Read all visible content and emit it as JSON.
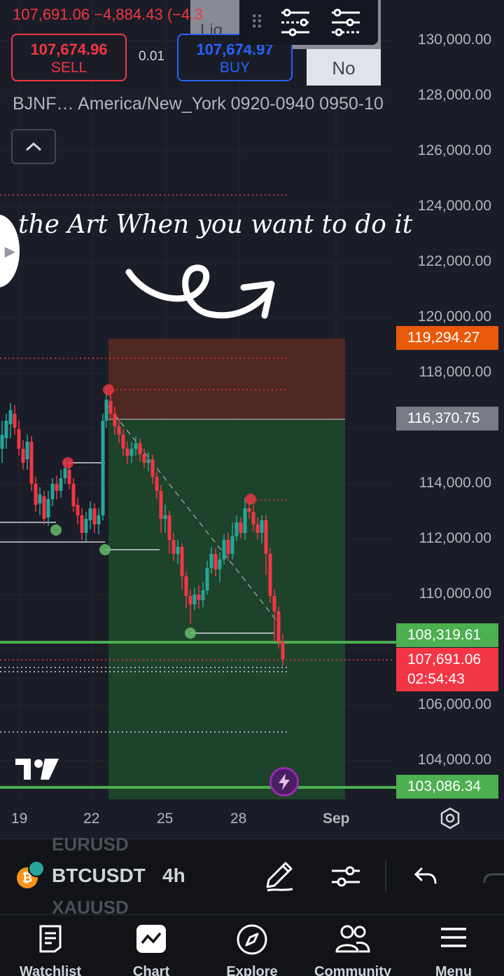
{
  "ticker": {
    "price": "107,691.06",
    "change": "−4,884.43",
    "change_pct": "(−4.3"
  },
  "trade_panel": {
    "sell_price": "107,674.96",
    "sell_label": "SELL",
    "spread": "0.01",
    "buy_price": "107,674.97",
    "buy_label": "BUY",
    "liq_text": "Liq",
    "no_label": "No"
  },
  "info_line": "BJNF… America/New_York 0920-0940 0950-10",
  "annotation": "the Art When you want to do it",
  "price_axis": {
    "labels": [
      "130,000.00",
      "128,000.00",
      "126,000.00",
      "124,000.00",
      "122,000.00",
      "120,000.00",
      "118,000.00",
      "114,000.00",
      "112,000.00",
      "110,000.00",
      "106,000.00",
      "104,000.00"
    ],
    "tag_stop": "119,294.27",
    "tag_entry": "116,370.75",
    "tag_line_upper": "108,319.61",
    "tag_last": "107,691.06",
    "tag_countdown": "02:54:43",
    "tag_line_lower": "103,086.34"
  },
  "time_axis": [
    "19",
    "22",
    "25",
    "28",
    "Sep"
  ],
  "colors": {
    "up": "#26a69a",
    "down": "#f23645",
    "stop_zone": "#5b2a22",
    "target_zone": "#1f4a2c",
    "level_line": "#4caf50",
    "stop_tag": "#e8590c",
    "entry_tag": "#787b86",
    "last_tag": "#f23645",
    "line_tag": "#4caf50"
  },
  "symbol_bar": {
    "ghost_top": "EURUSD",
    "symbol": "BTCUSDT",
    "ghost_bottom": "XAUUSD",
    "interval": "4h"
  },
  "nav": [
    {
      "label": "Watchlist",
      "icon": "watchlist-icon"
    },
    {
      "label": "Chart",
      "icon": "chart-icon"
    },
    {
      "label": "Explore",
      "icon": "compass-icon"
    },
    {
      "label": "Community",
      "icon": "community-icon"
    },
    {
      "label": "Menu",
      "icon": "menu-icon"
    }
  ]
}
